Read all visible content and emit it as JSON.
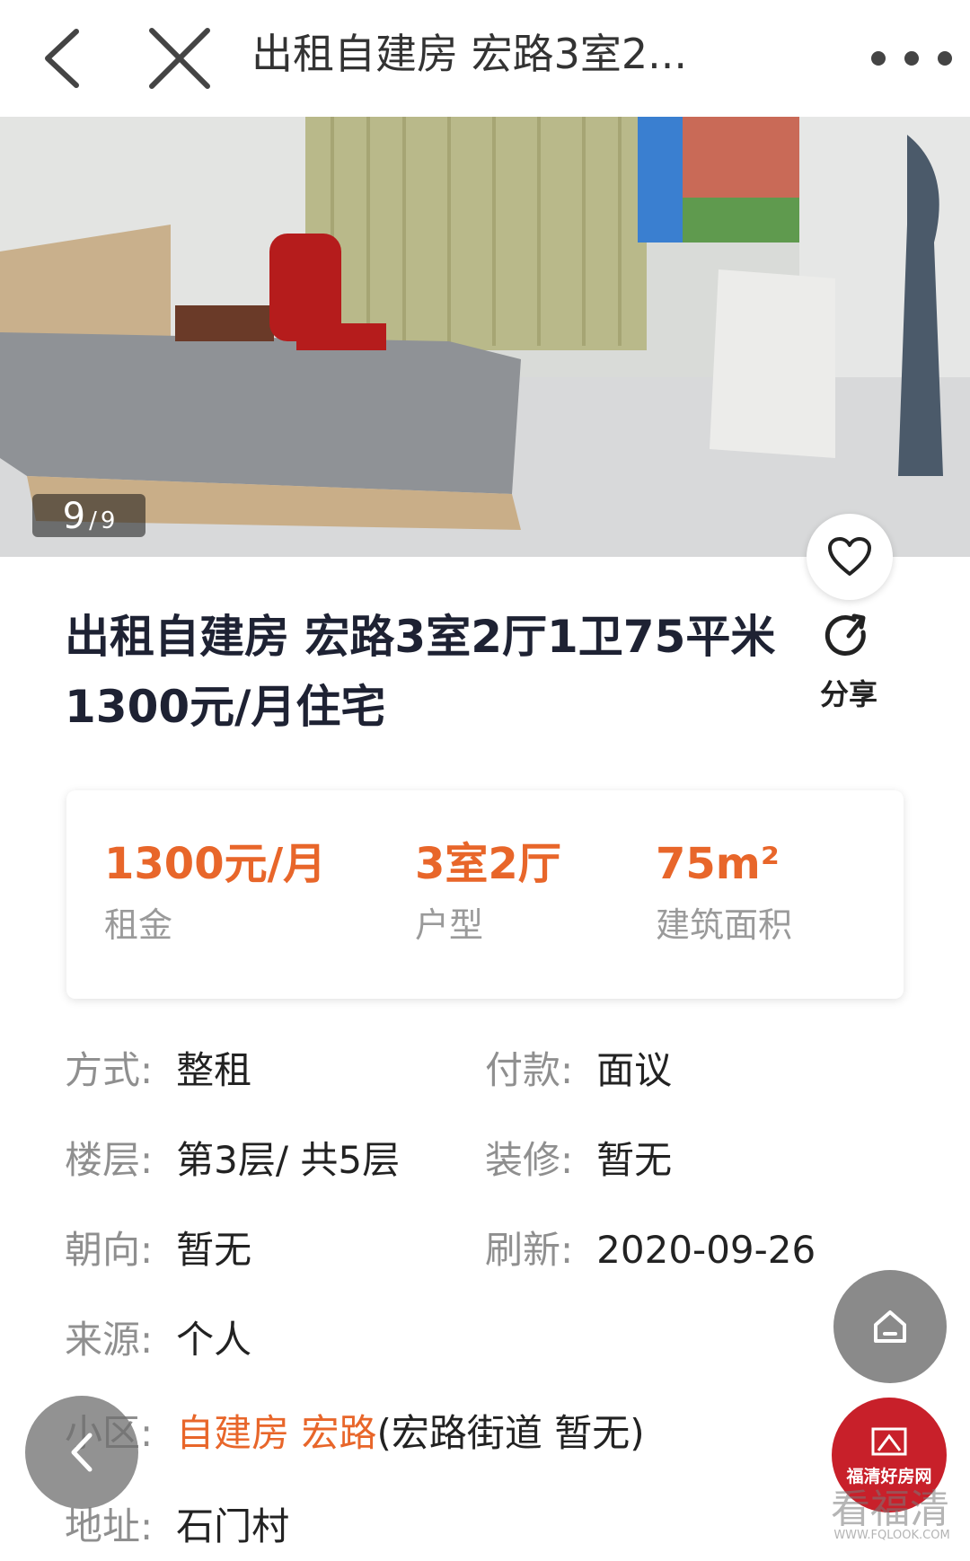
{
  "topbar": {
    "title": "出租自建房 宏路3室2...",
    "back_icon": "chevron-left-icon",
    "close_icon": "close-icon",
    "more_icon": "more-horizontal-icon"
  },
  "gallery": {
    "current": "9",
    "separator": "/",
    "total": "9"
  },
  "listing": {
    "title": "出租自建房 宏路3室2厅1卫75平米1300元/月住宅",
    "share_label": "分享"
  },
  "summary": {
    "rent_value": "1300元/月",
    "rent_label": "租金",
    "layout_value": "3室2厅",
    "layout_label": "户型",
    "area_value": "75m²",
    "area_label": "建筑面积"
  },
  "details": {
    "mode_key": "方式:",
    "mode_val": "整租",
    "payment_key": "付款:",
    "payment_val": "面议",
    "floor_key": "楼层:",
    "floor_val": "第3层/ 共5层",
    "decoration_key": "装修:",
    "decoration_val": "暂无",
    "orientation_key": "朝向:",
    "orientation_val": "暂无",
    "refresh_key": "刷新:",
    "refresh_val": "2020-09-26",
    "source_key": "来源:",
    "source_val": "个人",
    "community_key": "小区:",
    "community_link": "自建房 宏路",
    "community_extra": "(宏路街道 暂无)",
    "address_key": "地址:",
    "address_val": "石门村"
  },
  "branding": {
    "logo_text": "福清好房网",
    "watermark": "看福清",
    "watermark_url": "WWW.FQLOOK.COM"
  },
  "colors": {
    "accent": "#e8662a",
    "title": "#1e2233",
    "muted": "#8f8f8f",
    "logo_red": "#c8202a"
  }
}
